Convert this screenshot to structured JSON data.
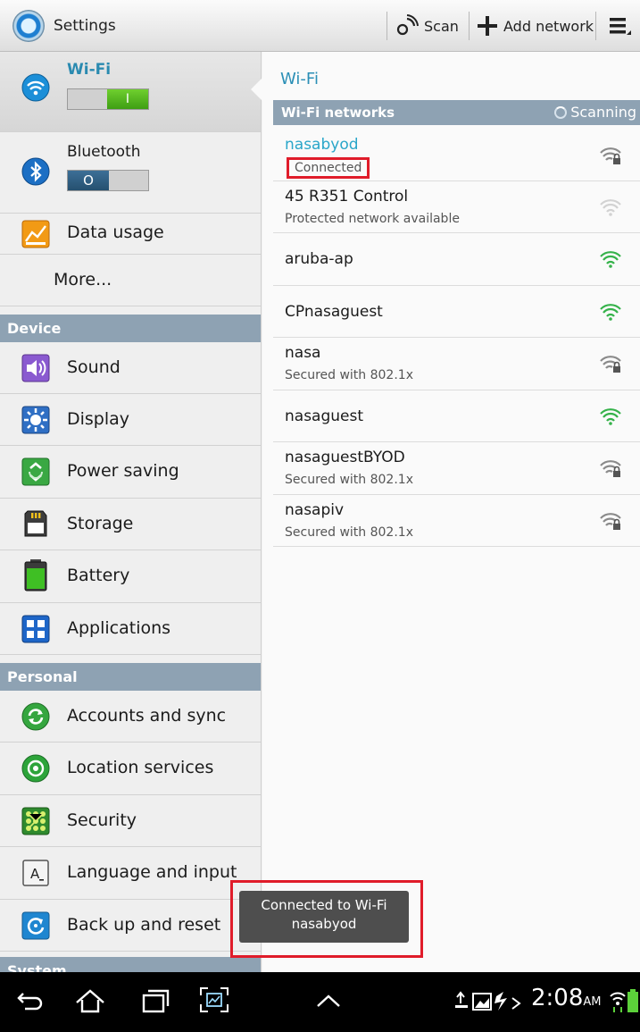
{
  "action_bar": {
    "title": "Settings",
    "scan_label": "Scan",
    "add_network_label": "Add network"
  },
  "sidebar": {
    "wifi_label": "Wi-Fi",
    "wifi_toggle": "I",
    "bluetooth_label": "Bluetooth",
    "bluetooth_toggle": "O",
    "data_usage_label": "Data usage",
    "more_label": "More...",
    "section_device": "Device",
    "device_items": [
      "Sound",
      "Display",
      "Power saving",
      "Storage",
      "Battery",
      "Applications"
    ],
    "section_personal": "Personal",
    "personal_items": [
      "Accounts and sync",
      "Location services",
      "Security",
      "Language and input",
      "Back up and reset"
    ],
    "section_system": "System"
  },
  "wifi_panel": {
    "title": "Wi-Fi",
    "networks_header": "Wi-Fi networks",
    "scanning_label": "Scanning",
    "networks": [
      {
        "name": "nasabyod",
        "status": "Connected"
      },
      {
        "name": "45 R351 Control",
        "status": "Protected network available"
      },
      {
        "name": "aruba-ap",
        "status": ""
      },
      {
        "name": "CPnasaguest",
        "status": ""
      },
      {
        "name": "nasa",
        "status": "Secured with 802.1x"
      },
      {
        "name": "nasaguest",
        "status": ""
      },
      {
        "name": "nasaguestBYOD",
        "status": "Secured with 802.1x"
      },
      {
        "name": "nasapiv",
        "status": "Secured with 802.1x"
      }
    ]
  },
  "toast": {
    "line1": "Connected to Wi-Fi",
    "line2": "nasabyod"
  },
  "status_bar": {
    "time": "2:08",
    "ampm": "AM"
  },
  "colors": {
    "accent": "#2aa6c9",
    "section_header": "#8ea2b3",
    "highlight": "#e01c2a"
  }
}
